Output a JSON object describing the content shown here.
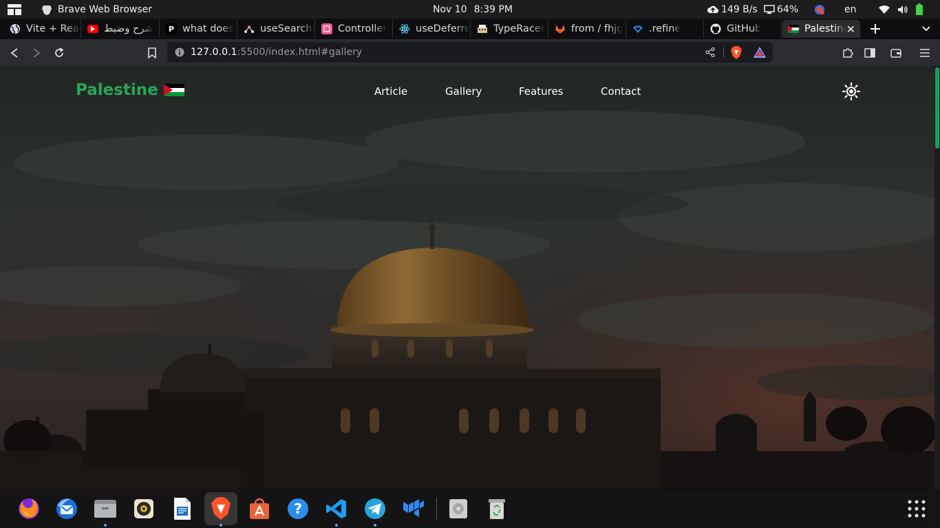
{
  "topbar": {
    "app_name": "Brave Web Browser",
    "date": "Nov 10",
    "time": "8:39 PM",
    "net_speed": "149 B/s",
    "battery": "64%",
    "language": "en"
  },
  "tabs": [
    {
      "title": "Vite + React",
      "icon": "globe-icon"
    },
    {
      "title": "شرح وضبط",
      "icon": "youtube-icon"
    },
    {
      "title": "what does",
      "icon": "p-icon"
    },
    {
      "title": "useSearchP",
      "icon": "remix-icon"
    },
    {
      "title": "Controller",
      "icon": "form-icon"
    },
    {
      "title": "useDeferre",
      "icon": "react-icon"
    },
    {
      "title": "TypeRacer",
      "icon": "typeracer-icon"
    },
    {
      "title": "from / fhjg",
      "icon": "gitlab-icon"
    },
    {
      "title": ".refine",
      "icon": "refine-icon"
    },
    {
      "title": "GitHub",
      "icon": "github-icon"
    },
    {
      "title": "Palestine",
      "icon": "palestine-flag-icon",
      "active": true
    }
  ],
  "toolbar": {
    "url_host": "127.0.0.1",
    "url_path": ":5500/index.html#gallery"
  },
  "site": {
    "logo": "Palestine",
    "nav": [
      "Article",
      "Gallery",
      "Features",
      "Contact"
    ]
  },
  "colors": {
    "brand": "#2aa55a",
    "scroll_thumb": "#16a05c",
    "topbar_bg": "#1d1d1d",
    "toolbar_bg": "#2b2c30"
  },
  "dock": {
    "apps": [
      "firefox-icon",
      "thunderbird-icon",
      "files-icon",
      "rhythmbox-icon",
      "libreoffice-writer-icon",
      "brave-icon",
      "app-center-icon",
      "help-icon",
      "vscode-icon",
      "telegram-icon",
      "mui-icon",
      "disk-icon",
      "trash-icon"
    ]
  }
}
